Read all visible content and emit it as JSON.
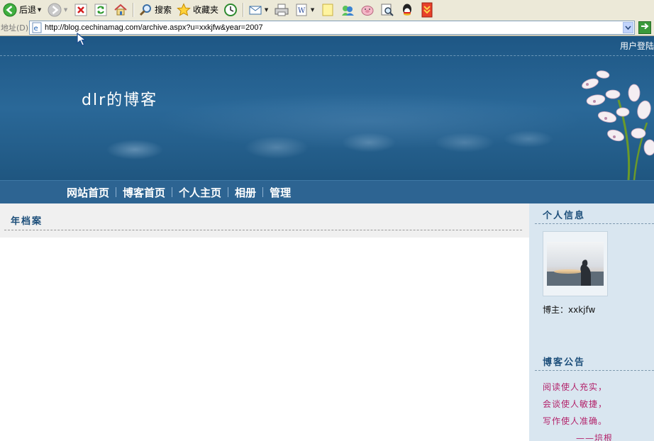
{
  "toolbar": {
    "back_label": "后退",
    "search_label": "搜索",
    "favorites_label": "收藏夹"
  },
  "address": {
    "label": "地址(D)",
    "url": "http://blog.cechinamag.com/archive.aspx?u=xxkjfw&year=2007"
  },
  "header": {
    "login_link": "用户登陆",
    "blog_title": "dlr的博客"
  },
  "nav": {
    "items": [
      {
        "label": "网站首页"
      },
      {
        "label": "博客首页"
      },
      {
        "label": "个人主页"
      },
      {
        "label": "相册"
      },
      {
        "label": "管理"
      }
    ]
  },
  "main": {
    "section_title": "年档案"
  },
  "sidebar": {
    "profile_title": "个人信息",
    "owner_text": "博主：xxkjfw",
    "notice_title": "博客公告",
    "notice_lines": [
      "阅读使人充实，",
      "会谈使人敏捷，",
      "写作使人准确。",
      "——培根"
    ]
  },
  "colors": {
    "banner": "#2a6898",
    "nav": "#2d6492",
    "heading": "#1c4e7a",
    "sidebar": "#d9e6f0",
    "notice_text": "#b3246b"
  },
  "icons": [
    "back-icon",
    "forward-icon",
    "stop-icon",
    "refresh-icon",
    "home-icon",
    "search-icon",
    "favorites-icon",
    "history-icon",
    "mail-icon",
    "print-icon",
    "word-icon",
    "note-icon",
    "messenger-icon",
    "pig-icon",
    "research-icon",
    "qq-icon",
    "download-icon",
    "page-icon",
    "go-icon"
  ]
}
